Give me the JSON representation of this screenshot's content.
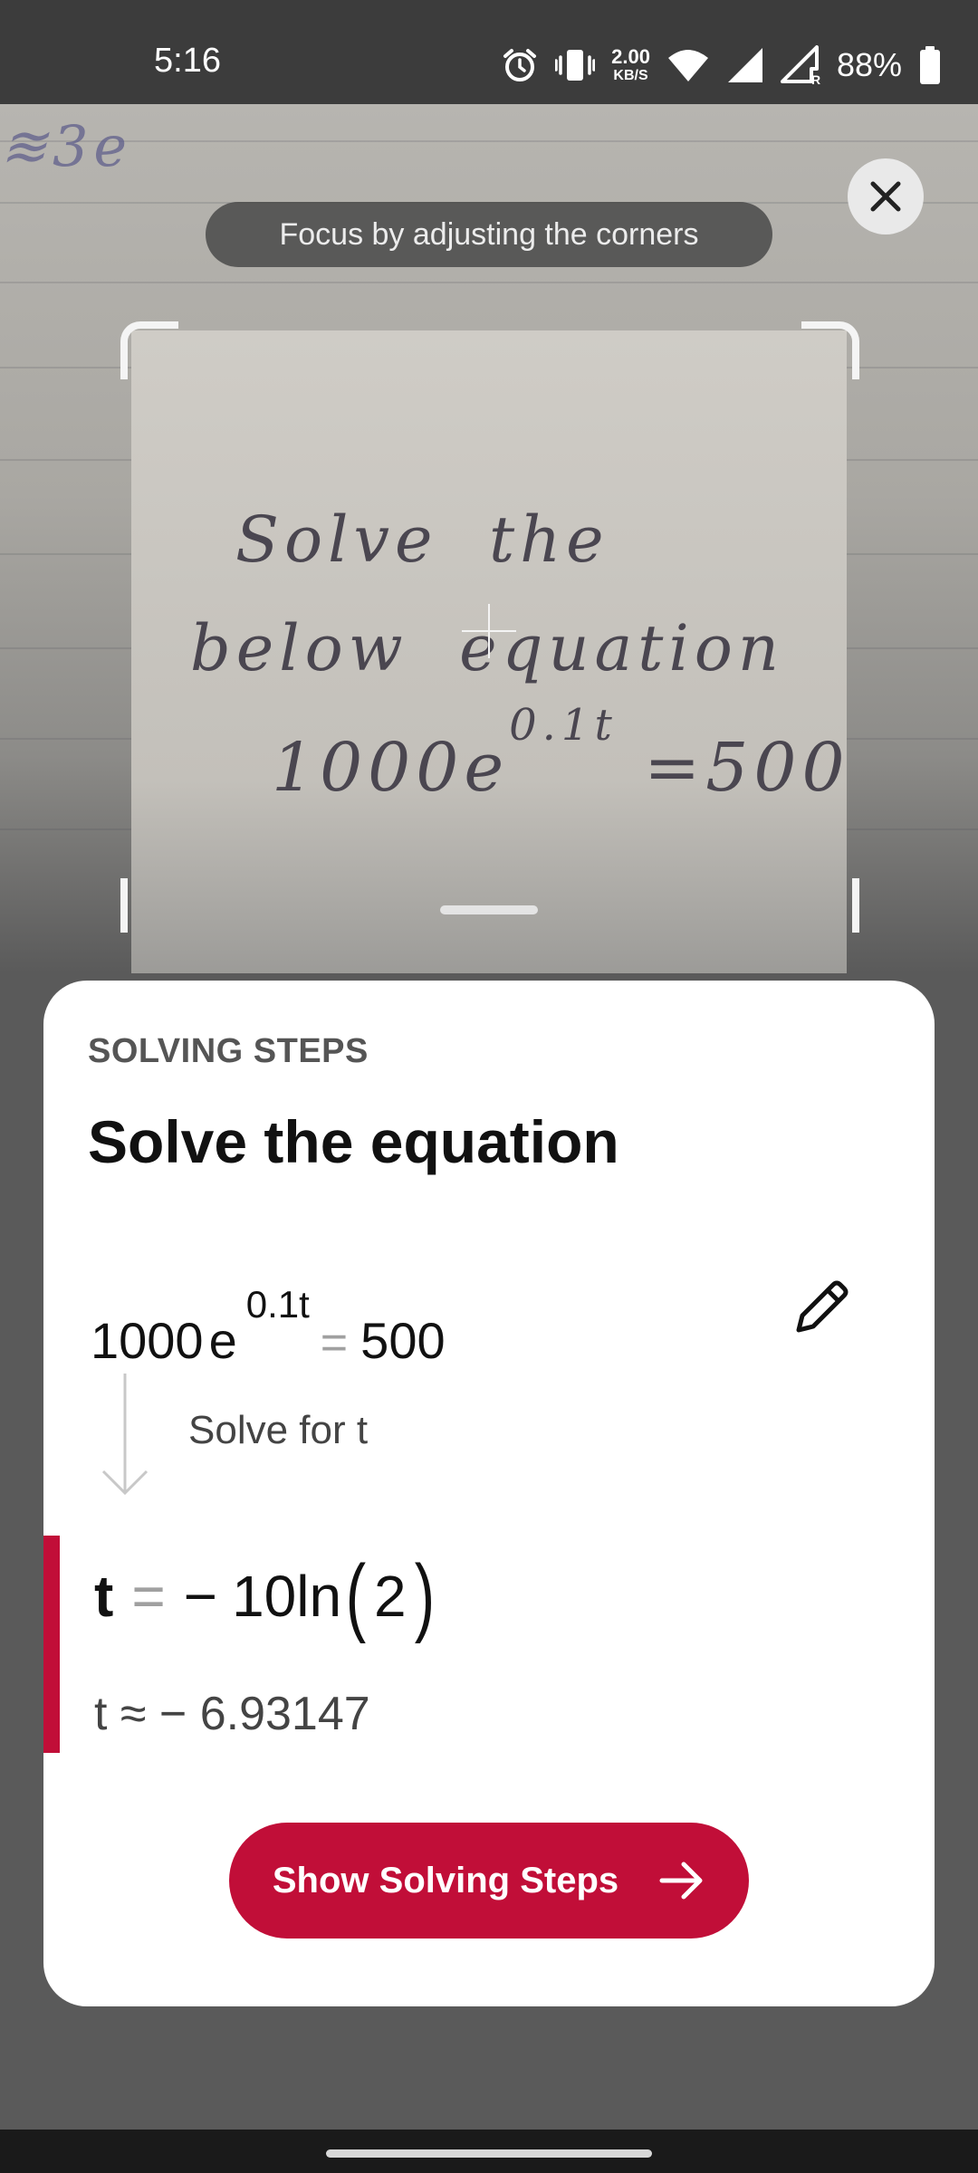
{
  "status_bar": {
    "time": "5:16",
    "net_speed_value": "2.00",
    "net_speed_unit": "KB/S",
    "battery_percent": "88%",
    "icons": [
      "alarm-icon",
      "vibrate-icon",
      "wifi-icon",
      "signal-icon",
      "signal-roaming-icon",
      "battery-icon"
    ]
  },
  "camera": {
    "focus_hint": "Focus by adjusting the corners",
    "close_icon": "close-icon"
  },
  "sheet": {
    "overline": "SOLVING STEPS",
    "title": "Solve the equation",
    "equation": {
      "coefficient": "1000",
      "base": "e",
      "exponent": "0.1t",
      "equals": "=",
      "rhs": "500"
    },
    "edit_icon": "pencil-icon",
    "step_label": "Solve for t",
    "result": {
      "variable": "t",
      "equals": "=",
      "minus": "−",
      "expression": "10ln",
      "open_paren": "(",
      "argument": "2",
      "close_paren": ")"
    },
    "approximation": "t ≈ − 6.93147",
    "button_label": "Show Solving Steps",
    "button_icon": "arrow-right-icon"
  },
  "colors": {
    "accent": "#c10e38",
    "sheet_bg": "#ffffff",
    "status_bar_bg": "#3c3c3c"
  }
}
